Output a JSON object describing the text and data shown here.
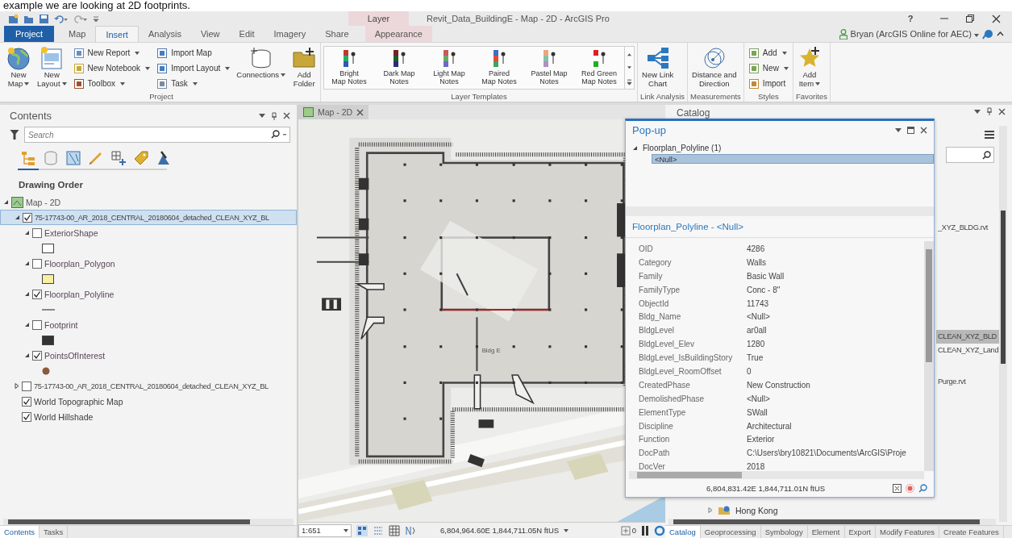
{
  "caption": "example we are looking at 2D footprints.",
  "title_bar": {
    "context_group": "Layer",
    "title": "Revit_Data_BuildingE - Map - 2D - ArcGIS Pro",
    "help": "?"
  },
  "tabs": [
    {
      "label": "Project",
      "kind": "file",
      "selected": false
    },
    {
      "label": "Map",
      "kind": "tab",
      "selected": false
    },
    {
      "label": "Insert",
      "kind": "tab",
      "selected": true
    },
    {
      "label": "Analysis",
      "kind": "tab",
      "selected": false
    },
    {
      "label": "View",
      "kind": "tab",
      "selected": false
    },
    {
      "label": "Edit",
      "kind": "tab",
      "selected": false
    },
    {
      "label": "Imagery",
      "kind": "tab",
      "selected": false
    },
    {
      "label": "Share",
      "kind": "tab",
      "selected": false
    },
    {
      "label": "Appearance",
      "kind": "contextual",
      "selected": false
    }
  ],
  "user": {
    "name": "Bryan (ArcGIS Online for AEC)"
  },
  "ribbon_groups": [
    {
      "label": "Project",
      "items": [
        {
          "kind": "large",
          "label": "New\nMap",
          "menu": true
        },
        {
          "kind": "large",
          "label": "New\nLayout",
          "menu": true
        },
        {
          "kind": "stack",
          "items": [
            {
              "label": "New Report",
              "menu": true
            },
            {
              "label": "New Notebook",
              "menu": true
            },
            {
              "label": "Toolbox",
              "menu": true
            }
          ]
        },
        {
          "kind": "stack",
          "items": [
            {
              "label": "Import Map",
              "menu": false
            },
            {
              "label": "Import Layout",
              "menu": true
            },
            {
              "label": "Task",
              "menu": true
            }
          ]
        },
        {
          "kind": "large",
          "label": "Connections",
          "menu": true
        },
        {
          "kind": "large",
          "label": "Add\nFolder",
          "menu": false
        }
      ]
    },
    {
      "label": "Layer Templates",
      "items": [
        {
          "kind": "gallery",
          "items": [
            {
              "label": "Bright\nMap Notes"
            },
            {
              "label": "Dark Map\nNotes"
            },
            {
              "label": "Light Map\nNotes"
            },
            {
              "label": "Paired\nMap Notes"
            },
            {
              "label": "Pastel Map\nNotes"
            },
            {
              "label": "Red Green\nMap Notes"
            }
          ]
        }
      ]
    },
    {
      "label": "Link Analysis",
      "items": [
        {
          "kind": "large",
          "label": "New Link\nChart",
          "menu": false
        }
      ]
    },
    {
      "label": "Measurements",
      "items": [
        {
          "kind": "large",
          "label": "Distance and\nDirection",
          "menu": false
        }
      ]
    },
    {
      "label": "Styles",
      "items": [
        {
          "kind": "stack",
          "items": [
            {
              "label": "Add",
              "menu": true
            },
            {
              "label": "New",
              "menu": true
            },
            {
              "label": "Import",
              "menu": false
            }
          ]
        }
      ]
    },
    {
      "label": "Favorites",
      "items": [
        {
          "kind": "large",
          "label": "Add\nItem",
          "menu": true
        }
      ]
    }
  ],
  "contents": {
    "title": "Contents",
    "search": {
      "placeholder": "Search"
    },
    "heading": "Drawing Order",
    "layers": [
      {
        "label": "Map - 2D",
        "kind": "map",
        "expanded": true,
        "selected": false,
        "children": [
          {
            "label": "75-17743-00_AR_2018_CENTRAL_20180604_detached_CLEAN_XYZ_BL",
            "kind": "group",
            "checked": true,
            "expanded": true,
            "selected": true,
            "children": [
              {
                "label": "ExteriorShape",
                "kind": "layer",
                "checked": false,
                "expanded": true,
                "selected": false,
                "symbol": {
                  "kind": "fill",
                  "color": "#ffffff"
                }
              },
              {
                "label": "Floorplan_Polygon",
                "kind": "layer",
                "checked": false,
                "expanded": true,
                "selected": false,
                "symbol": {
                  "kind": "fill",
                  "color": "#f6f0a0"
                }
              },
              {
                "label": "Floorplan_Polyline",
                "kind": "layer",
                "checked": true,
                "expanded": true,
                "selected": false,
                "symbol": {
                  "kind": "line",
                  "color": "#888888"
                }
              },
              {
                "label": "Footprint",
                "kind": "layer",
                "checked": false,
                "expanded": true,
                "selected": false,
                "symbol": {
                  "kind": "fill",
                  "color": "#333333"
                }
              },
              {
                "label": "PointsOfInterest",
                "kind": "layer",
                "checked": true,
                "expanded": true,
                "selected": false,
                "symbol": {
                  "kind": "marker",
                  "color": "#8b5a3c"
                }
              }
            ]
          },
          {
            "label": "75-17743-00_AR_2018_CENTRAL_20180604_detached_CLEAN_XYZ_BL",
            "kind": "group",
            "checked": false,
            "expanded": false,
            "selected": false
          },
          {
            "label": "World Topographic Map",
            "kind": "basemap",
            "checked": true,
            "selected": false
          },
          {
            "label": "World Hillshade",
            "kind": "basemap",
            "checked": true,
            "selected": false
          }
        ]
      }
    ],
    "tabs": [
      {
        "label": "Contents",
        "selected": true
      },
      {
        "label": "Tasks",
        "selected": false
      }
    ]
  },
  "map": {
    "tab": "Map - 2D",
    "building_label": "Bldg E",
    "scale": "1:651",
    "coordinates": "6,804,964.60E 1,844,711.05N ftUS",
    "selection_count": "0"
  },
  "popup": {
    "title": "Pop-up",
    "tree": {
      "label": "Floorplan_Polyline  (1)",
      "expanded": true,
      "children": [
        {
          "label": "<Null>",
          "selected": true
        }
      ]
    },
    "heading": "Floorplan_Polyline - <Null>",
    "fields": [
      {
        "name": "OID",
        "value": "4286"
      },
      {
        "name": "Category",
        "value": "Walls"
      },
      {
        "name": "Family",
        "value": "Basic Wall"
      },
      {
        "name": "FamilyType",
        "value": "Conc - 8\""
      },
      {
        "name": "ObjectId",
        "value": "11743"
      },
      {
        "name": "Bldg_Name",
        "value": "<Null>"
      },
      {
        "name": "BldgLevel",
        "value": "ar0all"
      },
      {
        "name": "BldgLevel_Elev",
        "value": "1280"
      },
      {
        "name": "BldgLevel_IsBuildingStory",
        "value": "True"
      },
      {
        "name": "BldgLevel_RoomOffset",
        "value": "0"
      },
      {
        "name": "CreatedPhase",
        "value": "New Construction"
      },
      {
        "name": "DemolishedPhase",
        "value": "<Null>"
      },
      {
        "name": "ElementType",
        "value": "SWall"
      },
      {
        "name": "Discipline",
        "value": "Architectural"
      },
      {
        "name": "Function",
        "value": "Exterior"
      },
      {
        "name": "DocPath",
        "value": "C:\\Users\\bry10821\\Documents\\ArcGIS\\Proje"
      },
      {
        "name": "DocVer",
        "value": "2018"
      }
    ],
    "coordinates": "6,804,831.42E 1,844,711.01N ftUS"
  },
  "catalog": {
    "title": "Catalog",
    "items": [
      {
        "label": "_XYZ_BLDG.rvt",
        "selected": false
      },
      {
        "label": "CLEAN_XYZ_BLD",
        "selected": true
      },
      {
        "label": "CLEAN_XYZ_Land",
        "selected": false
      },
      {
        "label": "Purge.rvt",
        "selected": false
      }
    ],
    "folder": {
      "label": "Hong Kong",
      "expanded": false
    },
    "tabs": [
      {
        "label": "Catalog",
        "selected": true
      },
      {
        "label": "Geoprocessing",
        "selected": false
      },
      {
        "label": "Symbology",
        "selected": false
      },
      {
        "label": "Element",
        "selected": false
      },
      {
        "label": "Export",
        "selected": false
      },
      {
        "label": "Modify Features",
        "selected": false
      },
      {
        "label": "Create Features",
        "selected": false
      }
    ]
  }
}
